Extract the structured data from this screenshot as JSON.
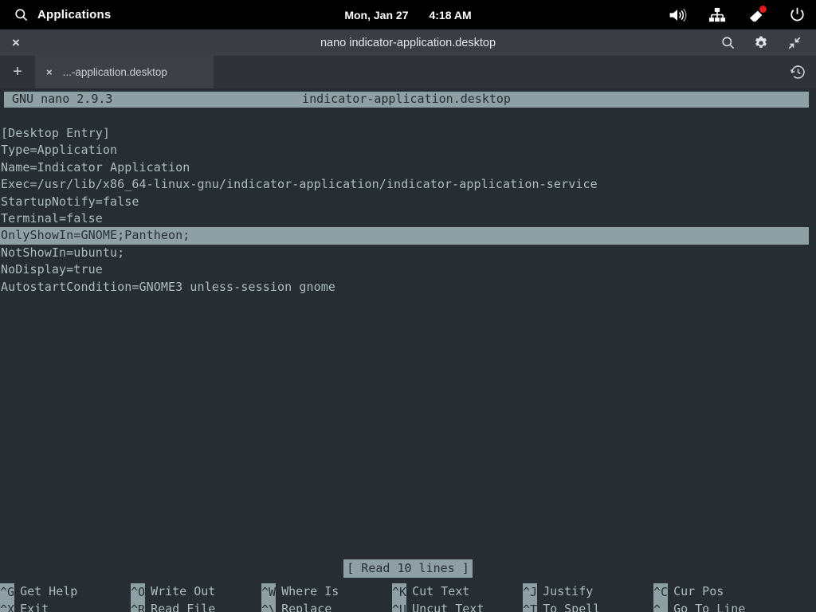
{
  "system_bar": {
    "apps_label": "Applications",
    "search_icon": "search-icon",
    "date": "Mon, Jan 27",
    "time": "4:18 AM",
    "tray": [
      {
        "icon": "volume-icon",
        "badge": false
      },
      {
        "icon": "network-icon",
        "badge": false
      },
      {
        "icon": "notification-bell-icon",
        "badge": true
      },
      {
        "icon": "power-icon",
        "badge": false
      }
    ],
    "badge_color": "#e01b1b",
    "background": "#000000"
  },
  "window": {
    "title": "nano indicator-application.desktop",
    "close_label": "×",
    "actions": [
      {
        "icon": "search-icon",
        "name": "window-search-button"
      },
      {
        "icon": "gear-icon",
        "name": "window-settings-button"
      },
      {
        "icon": "shrink-icon",
        "name": "window-shrink-button"
      }
    ],
    "background": "#3a3e44"
  },
  "tabbar": {
    "new_tab_label": "+",
    "tabs": [
      {
        "close_label": "×",
        "label": "...-application.desktop",
        "active": true
      }
    ],
    "history_icon": "history-icon",
    "background": "#2f3338",
    "active_tab_background": "#3d4147"
  },
  "terminal": {
    "background": "#262e33",
    "foreground": "#aebcc0",
    "inverted_background": "#8fa0a4",
    "inverted_foreground": "#262e33",
    "header": {
      "version": "GNU nano 2.9.3",
      "filename": "indicator-application.desktop"
    },
    "lines": [
      {
        "text": "[Desktop Entry]",
        "highlight": false
      },
      {
        "text": "Type=Application",
        "highlight": false
      },
      {
        "text": "Name=Indicator Application",
        "highlight": false
      },
      {
        "text": "Exec=/usr/lib/x86_64-linux-gnu/indicator-application/indicator-application-service",
        "highlight": false
      },
      {
        "text": "StartupNotify=false",
        "highlight": false
      },
      {
        "text": "Terminal=false",
        "highlight": false
      },
      {
        "text": "OnlyShowIn=GNOME;Pantheon;",
        "highlight": true
      },
      {
        "text": "NotShowIn=ubuntu;",
        "highlight": false
      },
      {
        "text": "NoDisplay=true",
        "highlight": false
      },
      {
        "text": "AutostartCondition=GNOME3 unless-session gnome",
        "highlight": false
      }
    ],
    "status_message": "[ Read 10 lines ]",
    "shortcuts": {
      "row1": [
        {
          "key": "^G",
          "label": "Get Help"
        },
        {
          "key": "^O",
          "label": "Write Out"
        },
        {
          "key": "^W",
          "label": "Where Is"
        },
        {
          "key": "^K",
          "label": "Cut Text"
        },
        {
          "key": "^J",
          "label": "Justify"
        },
        {
          "key": "^C",
          "label": "Cur Pos"
        }
      ],
      "row2": [
        {
          "key": "^X",
          "label": "Exit"
        },
        {
          "key": "^R",
          "label": "Read File"
        },
        {
          "key": "^\\",
          "label": "Replace"
        },
        {
          "key": "^U",
          "label": "Uncut Text"
        },
        {
          "key": "^T",
          "label": "To Spell"
        },
        {
          "key": "^_",
          "label": "Go To Line"
        }
      ]
    }
  }
}
